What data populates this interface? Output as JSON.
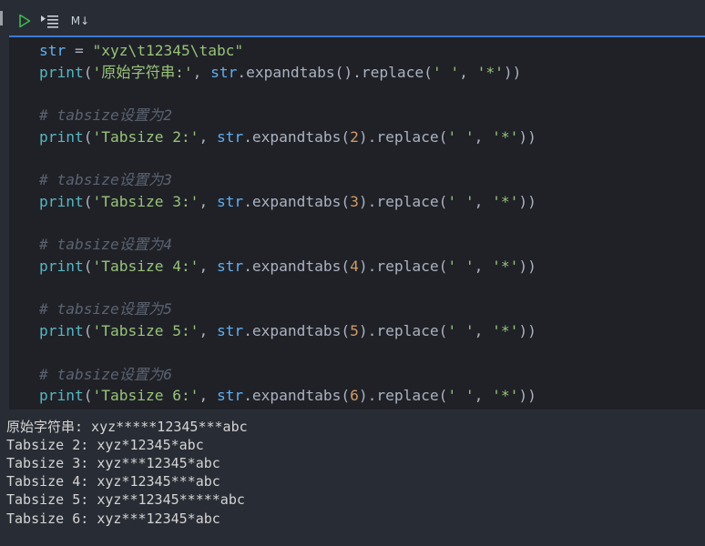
{
  "toolbar": {
    "run_icon": "play-icon",
    "run_by_line_icon": "run-by-line-icon",
    "markdown_label": "M↓"
  },
  "code": [
    {
      "kind": "code",
      "tokens": [
        {
          "t": "var",
          "v": "str"
        },
        {
          "t": "op",
          "v": " = "
        },
        {
          "t": "str",
          "v": "\"xyz\\t12345\\tabc\""
        }
      ]
    },
    {
      "kind": "code",
      "tokens": [
        {
          "t": "fn",
          "v": "print"
        },
        {
          "t": "op",
          "v": "("
        },
        {
          "t": "str",
          "v": "'原始字符串:'"
        },
        {
          "t": "op",
          "v": ", "
        },
        {
          "t": "var",
          "v": "str"
        },
        {
          "t": "op",
          "v": ".expandtabs().replace("
        },
        {
          "t": "str",
          "v": "' '"
        },
        {
          "t": "op",
          "v": ", "
        },
        {
          "t": "str",
          "v": "'*'"
        },
        {
          "t": "op",
          "v": "))"
        }
      ]
    },
    {
      "kind": "blank",
      "tokens": []
    },
    {
      "kind": "comment",
      "tokens": [
        {
          "t": "com",
          "v": "# tabsize设置为2"
        }
      ]
    },
    {
      "kind": "code",
      "tokens": [
        {
          "t": "fn",
          "v": "print"
        },
        {
          "t": "op",
          "v": "("
        },
        {
          "t": "str",
          "v": "'Tabsize 2:'"
        },
        {
          "t": "op",
          "v": ", "
        },
        {
          "t": "var",
          "v": "str"
        },
        {
          "t": "op",
          "v": ".expandtabs("
        },
        {
          "t": "num",
          "v": "2"
        },
        {
          "t": "op",
          "v": ").replace("
        },
        {
          "t": "str",
          "v": "' '"
        },
        {
          "t": "op",
          "v": ", "
        },
        {
          "t": "str",
          "v": "'*'"
        },
        {
          "t": "op",
          "v": "))"
        }
      ]
    },
    {
      "kind": "blank",
      "tokens": []
    },
    {
      "kind": "comment",
      "tokens": [
        {
          "t": "com",
          "v": "# tabsize设置为3"
        }
      ]
    },
    {
      "kind": "code",
      "tokens": [
        {
          "t": "fn",
          "v": "print"
        },
        {
          "t": "op",
          "v": "("
        },
        {
          "t": "str",
          "v": "'Tabsize 3:'"
        },
        {
          "t": "op",
          "v": ", "
        },
        {
          "t": "var",
          "v": "str"
        },
        {
          "t": "op",
          "v": ".expandtabs("
        },
        {
          "t": "num",
          "v": "3"
        },
        {
          "t": "op",
          "v": ").replace("
        },
        {
          "t": "str",
          "v": "' '"
        },
        {
          "t": "op",
          "v": ", "
        },
        {
          "t": "str",
          "v": "'*'"
        },
        {
          "t": "op",
          "v": "))"
        }
      ]
    },
    {
      "kind": "blank",
      "tokens": []
    },
    {
      "kind": "comment",
      "tokens": [
        {
          "t": "com",
          "v": "# tabsize设置为4"
        }
      ]
    },
    {
      "kind": "code",
      "tokens": [
        {
          "t": "fn",
          "v": "print"
        },
        {
          "t": "op",
          "v": "("
        },
        {
          "t": "str",
          "v": "'Tabsize 4:'"
        },
        {
          "t": "op",
          "v": ", "
        },
        {
          "t": "var",
          "v": "str"
        },
        {
          "t": "op",
          "v": ".expandtabs("
        },
        {
          "t": "num",
          "v": "4"
        },
        {
          "t": "op",
          "v": ").replace("
        },
        {
          "t": "str",
          "v": "' '"
        },
        {
          "t": "op",
          "v": ", "
        },
        {
          "t": "str",
          "v": "'*'"
        },
        {
          "t": "op",
          "v": "))"
        }
      ]
    },
    {
      "kind": "blank",
      "tokens": []
    },
    {
      "kind": "comment",
      "tokens": [
        {
          "t": "com",
          "v": "# tabsize设置为5"
        }
      ]
    },
    {
      "kind": "code",
      "tokens": [
        {
          "t": "fn",
          "v": "print"
        },
        {
          "t": "op",
          "v": "("
        },
        {
          "t": "str",
          "v": "'Tabsize 5:'"
        },
        {
          "t": "op",
          "v": ", "
        },
        {
          "t": "var",
          "v": "str"
        },
        {
          "t": "op",
          "v": ".expandtabs("
        },
        {
          "t": "num",
          "v": "5"
        },
        {
          "t": "op",
          "v": ").replace("
        },
        {
          "t": "str",
          "v": "' '"
        },
        {
          "t": "op",
          "v": ", "
        },
        {
          "t": "str",
          "v": "'*'"
        },
        {
          "t": "op",
          "v": "))"
        }
      ]
    },
    {
      "kind": "blank",
      "tokens": []
    },
    {
      "kind": "comment",
      "tokens": [
        {
          "t": "com",
          "v": "# tabsize设置为6"
        }
      ]
    },
    {
      "kind": "code",
      "tokens": [
        {
          "t": "fn",
          "v": "print"
        },
        {
          "t": "op",
          "v": "("
        },
        {
          "t": "str",
          "v": "'Tabsize 6:'"
        },
        {
          "t": "op",
          "v": ", "
        },
        {
          "t": "var",
          "v": "str"
        },
        {
          "t": "op",
          "v": ".expandtabs("
        },
        {
          "t": "num",
          "v": "6"
        },
        {
          "t": "op",
          "v": ").replace("
        },
        {
          "t": "str",
          "v": "' '"
        },
        {
          "t": "op",
          "v": ", "
        },
        {
          "t": "str",
          "v": "'*'"
        },
        {
          "t": "op",
          "v": "))"
        }
      ]
    }
  ],
  "output": [
    "原始字符串: xyz*****12345***abc",
    "Tabsize 2: xyz*12345*abc",
    "Tabsize 3: xyz***12345*abc",
    "Tabsize 4: xyz*12345***abc",
    "Tabsize 5: xyz**12345*****abc",
    "Tabsize 6: xyz***12345*abc"
  ],
  "colors": {
    "accent": "#3e7ad6",
    "run_icon": "#3fb950",
    "editor_bg": "#1f2127",
    "panel_bg": "#282c34"
  }
}
